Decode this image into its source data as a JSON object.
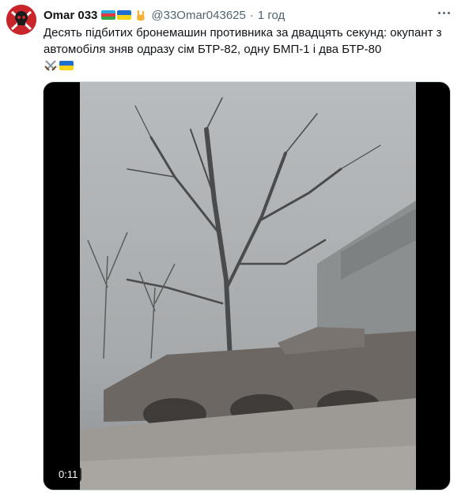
{
  "tweet": {
    "author": {
      "display_name": "Omar 033",
      "handle": "@33Omar043625",
      "avatar_icon": "pirate-skull-avatar",
      "name_emoji": [
        "azerbaijan-flag-icon",
        "ukraine-flag-icon",
        "rock-on-hand-icon"
      ]
    },
    "separator": "·",
    "timestamp": "1 год",
    "text": "Десять підбитих бронемашин противника за двадцять секунд: окупант з автомобіля зняв одразу сім БТР-82, одну БМП-1 і два БТР-80",
    "text_emoji": [
      "crossed-swords-icon",
      "ukraine-flag-icon"
    ],
    "more_icon": "more-dots-icon",
    "media": {
      "type": "video",
      "duration": "0:11"
    },
    "colors": {
      "text": "#0f1419",
      "secondary": "#536471",
      "avatar_bg": "#c8262b",
      "flag_ua_blue": "#1f6fd1",
      "flag_ua_yellow": "#f7d417"
    }
  }
}
